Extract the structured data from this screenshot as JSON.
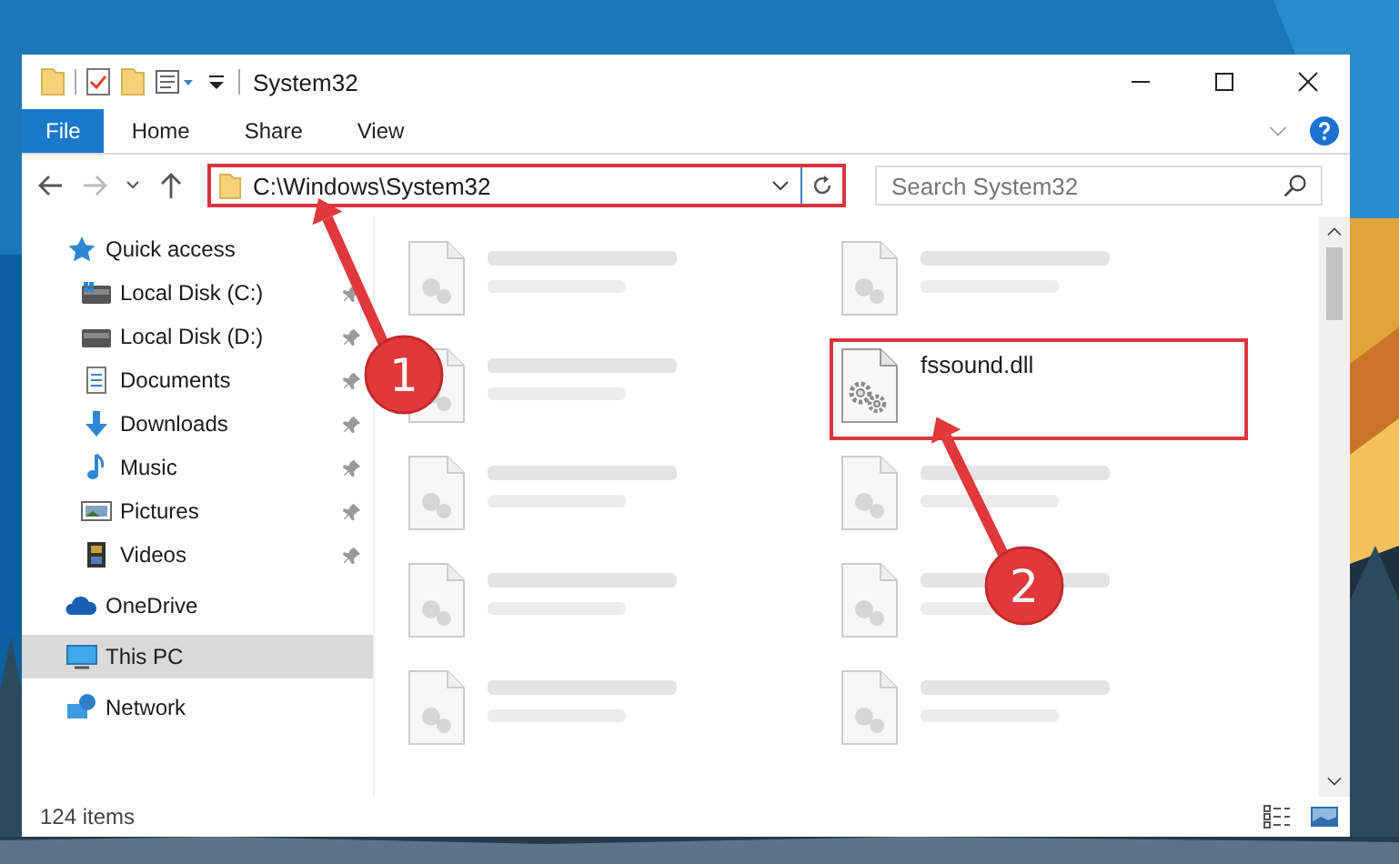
{
  "window": {
    "title": "System32"
  },
  "ribbon": {
    "tabs": [
      {
        "label": "File",
        "kind": "file"
      },
      {
        "label": "Home",
        "kind": "tab"
      },
      {
        "label": "Share",
        "kind": "tab"
      },
      {
        "label": "View",
        "kind": "tab"
      }
    ]
  },
  "address_bar": {
    "path": "C:\\Windows\\System32",
    "highlighted": true
  },
  "search": {
    "placeholder": "Search System32"
  },
  "sidebar": {
    "items": [
      {
        "label": "Quick access",
        "kind": "star",
        "selected": false,
        "children": [
          {
            "label": "Local Disk (C:)",
            "kind": "system-drive",
            "pinned": true,
            "selected": false
          },
          {
            "label": "Local Disk (D:)",
            "kind": "drive",
            "pinned": true,
            "selected": false
          },
          {
            "label": "Documents",
            "kind": "documents",
            "pinned": true,
            "selected": false
          },
          {
            "label": "Downloads",
            "kind": "downloads",
            "pinned": true,
            "selected": false
          },
          {
            "label": "Music",
            "kind": "music",
            "pinned": true,
            "selected": false
          },
          {
            "label": "Pictures",
            "kind": "pictures",
            "pinned": true,
            "selected": false
          },
          {
            "label": "Videos",
            "kind": "videos",
            "pinned": true,
            "selected": false
          }
        ]
      },
      {
        "label": "OneDrive",
        "kind": "cloud",
        "selected": false
      },
      {
        "label": "This PC",
        "kind": "pc",
        "selected": true
      },
      {
        "label": "Network",
        "kind": "network",
        "selected": false
      }
    ]
  },
  "files": [
    {
      "kind": "blurred"
    },
    {
      "kind": "blurred"
    },
    {
      "kind": "blurred"
    },
    {
      "kind": "file",
      "name": "fssound.dll",
      "highlighted": true
    },
    {
      "kind": "blurred"
    },
    {
      "kind": "blurred"
    },
    {
      "kind": "blurred"
    },
    {
      "kind": "blurred"
    },
    {
      "kind": "blurred"
    },
    {
      "kind": "blurred"
    }
  ],
  "status_bar": {
    "item_count": "124 items"
  },
  "annotations": [
    {
      "label": "1"
    },
    {
      "label": "2"
    }
  ]
}
